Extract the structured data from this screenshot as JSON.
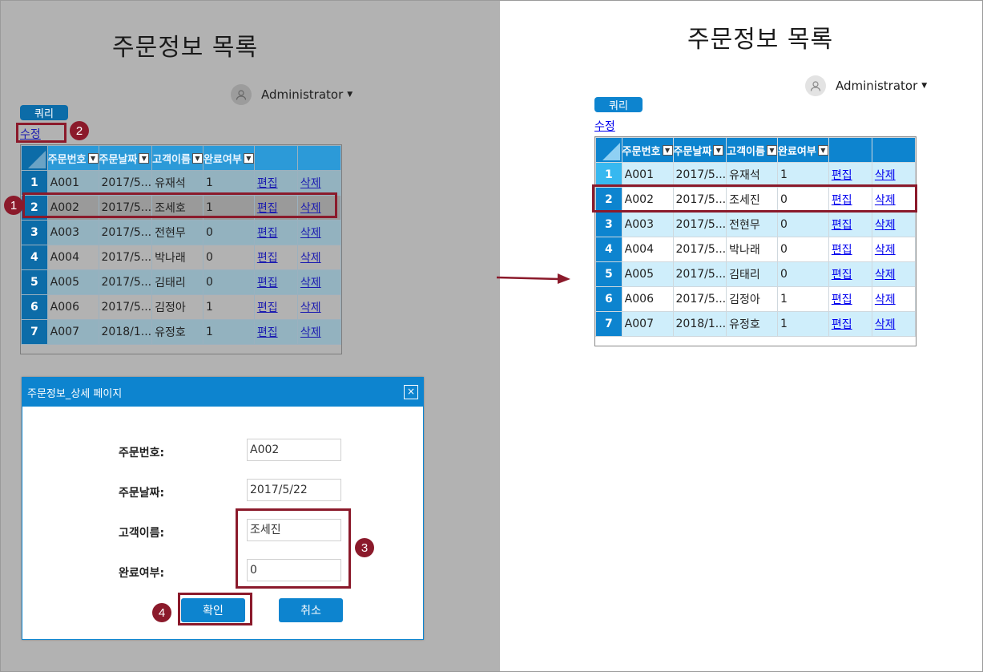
{
  "left_panel": {
    "title": "주문정보 목록",
    "user": "Administrator",
    "query_button": "쿼리",
    "edit_link": "수정",
    "grid": {
      "columns": [
        "주문번호",
        "주문날짜",
        "고객이름",
        "완료여부",
        "",
        ""
      ],
      "rows": [
        {
          "num": "1",
          "id": "A001",
          "date": "2017/5...",
          "name": "유재석",
          "done": "1",
          "edit": "편집",
          "del": "삭제"
        },
        {
          "num": "2",
          "id": "A002",
          "date": "2017/5...",
          "name": "조세호",
          "done": "1",
          "edit": "편집",
          "del": "삭제"
        },
        {
          "num": "3",
          "id": "A003",
          "date": "2017/5...",
          "name": "전현무",
          "done": "0",
          "edit": "편집",
          "del": "삭제"
        },
        {
          "num": "4",
          "id": "A004",
          "date": "2017/5...",
          "name": "박나래",
          "done": "0",
          "edit": "편집",
          "del": "삭제"
        },
        {
          "num": "5",
          "id": "A005",
          "date": "2017/5...",
          "name": "김태리",
          "done": "0",
          "edit": "편집",
          "del": "삭제"
        },
        {
          "num": "6",
          "id": "A006",
          "date": "2017/5...",
          "name": "김정아",
          "done": "1",
          "edit": "편집",
          "del": "삭제"
        },
        {
          "num": "7",
          "id": "A007",
          "date": "2018/1...",
          "name": "유정호",
          "done": "1",
          "edit": "편집",
          "del": "삭제"
        }
      ]
    }
  },
  "dialog": {
    "title": "주문정보_상세 페이지",
    "close": "×",
    "fields": [
      {
        "label": "주문번호:",
        "value": "A002"
      },
      {
        "label": "주문날짜:",
        "value": "2017/5/22"
      },
      {
        "label": "고객이름:",
        "value": "조세진"
      },
      {
        "label": "완료여부:",
        "value": "0"
      }
    ],
    "ok_button": "확인",
    "cancel_button": "취소"
  },
  "right_panel": {
    "title": "주문정보 목록",
    "user": "Administrator",
    "query_button": "쿼리",
    "edit_link": "수정",
    "grid": {
      "columns": [
        "주문번호",
        "주문날짜",
        "고객이름",
        "완료여부",
        "",
        ""
      ],
      "rows": [
        {
          "num": "1",
          "id": "A001",
          "date": "2017/5...",
          "name": "유재석",
          "done": "1",
          "edit": "편집",
          "del": "삭제"
        },
        {
          "num": "2",
          "id": "A002",
          "date": "2017/5...",
          "name": "조세진",
          "done": "0",
          "edit": "편집",
          "del": "삭제"
        },
        {
          "num": "3",
          "id": "A003",
          "date": "2017/5...",
          "name": "전현무",
          "done": "0",
          "edit": "편집",
          "del": "삭제"
        },
        {
          "num": "4",
          "id": "A004",
          "date": "2017/5...",
          "name": "박나래",
          "done": "0",
          "edit": "편집",
          "del": "삭제"
        },
        {
          "num": "5",
          "id": "A005",
          "date": "2017/5...",
          "name": "김태리",
          "done": "0",
          "edit": "편집",
          "del": "삭제"
        },
        {
          "num": "6",
          "id": "A006",
          "date": "2017/5...",
          "name": "김정아",
          "done": "1",
          "edit": "편집",
          "del": "삭제"
        },
        {
          "num": "7",
          "id": "A007",
          "date": "2018/1...",
          "name": "유정호",
          "done": "1",
          "edit": "편집",
          "del": "삭제"
        }
      ]
    }
  },
  "annotations": {
    "badges": [
      "1",
      "2",
      "3",
      "4"
    ],
    "color": "#8b1a2b"
  },
  "colors": {
    "accent": "#0d84cf",
    "row_alt": "#cfeefb",
    "selected_row_header": "#37b8f0"
  }
}
